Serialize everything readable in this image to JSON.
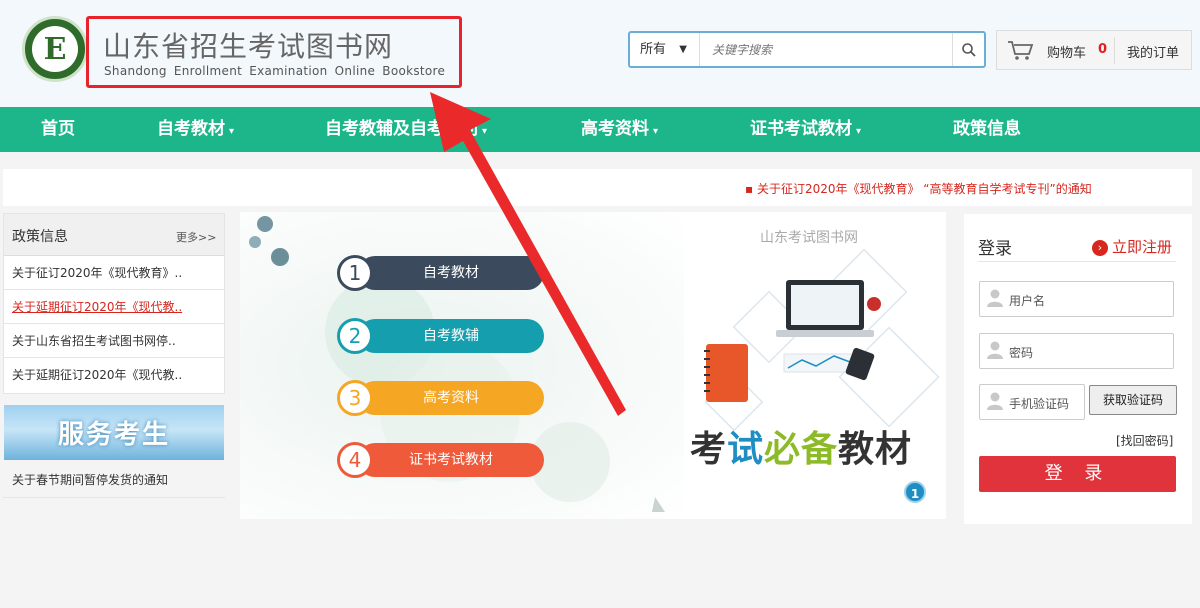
{
  "header": {
    "logo_letter": "E",
    "title": "山东省招生考试图书网",
    "subtitle": "Shandong  Enrollment  Examination  Online Bookstore",
    "search": {
      "scope": "所有",
      "placeholder": "关键字搜索"
    },
    "cart_label": "购物车",
    "cart_count": "0",
    "orders_label": "我的订单"
  },
  "nav": {
    "items": [
      {
        "label": "首页"
      },
      {
        "label": "自考教材"
      },
      {
        "label": "自考教辅及自考专刊"
      },
      {
        "label": "高考资料"
      },
      {
        "label": "证书考试教材"
      },
      {
        "label": "政策信息"
      }
    ],
    "dropdown_glyph": "▾"
  },
  "notice": {
    "text": "▪ 关于征订2020年《现代教育》 “高等教育自学考试专刊”的通知"
  },
  "policy": {
    "title": "政策信息",
    "more": "更多>>",
    "items": [
      "关于征订2020年《现代教育》..",
      "关于延期征订2020年《现代教..",
      "关于山东省招生考试图书网停..",
      "关于延期征订2020年《现代教.."
    ],
    "service_banner": "服务考生",
    "service_note": "关于春节期间暂停发货的通知"
  },
  "slider": {
    "pills": [
      {
        "num": "1",
        "label": "自考教材",
        "color": "#3b4a5c"
      },
      {
        "num": "2",
        "label": "自考教辅",
        "color": "#159fae"
      },
      {
        "num": "3",
        "label": "高考资料",
        "color": "#f5a623"
      },
      {
        "num": "4",
        "label": "证书考试教材",
        "color": "#ee5a3a"
      }
    ],
    "brand": "山东考试图书网",
    "headline_1": "考",
    "headline_2": "试",
    "headline_3": "必备",
    "headline_4": "教材",
    "indicator": "1"
  },
  "login": {
    "title": "登录",
    "register": "立即注册",
    "username_placeholder": "用户名",
    "password_placeholder": "密码",
    "phone_code_placeholder": "手机验证码",
    "get_code": "获取验证码",
    "find_password": "[找回密码]",
    "submit": "登 录"
  },
  "colors": {
    "nav": "#1db68a",
    "accent_red": "#e0333b",
    "annotation": "#e8232b"
  }
}
